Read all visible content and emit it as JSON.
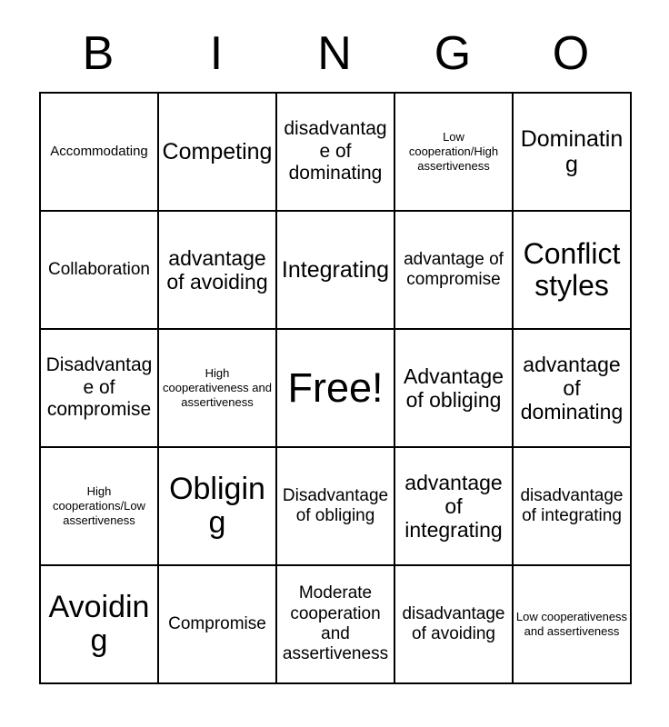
{
  "card": {
    "title_letters": [
      "B",
      "I",
      "N",
      "G",
      "O"
    ],
    "free_space_label": "Free!",
    "rows": [
      [
        {
          "text": "Accommodating",
          "size": "sm"
        },
        {
          "text": "Competing",
          "size": "2xl"
        },
        {
          "text": "disadvantage of dominating",
          "size": "lg"
        },
        {
          "text": "Low cooperation/High assertiveness",
          "size": "xs"
        },
        {
          "text": "Dominating",
          "size": "2xl"
        }
      ],
      [
        {
          "text": "Collaboration",
          "size": "md"
        },
        {
          "text": "advantage of avoiding",
          "size": "xl"
        },
        {
          "text": "Integrating",
          "size": "2xl"
        },
        {
          "text": "advantage of compromise",
          "size": "md"
        },
        {
          "text": "Conflict styles",
          "size": "3xl"
        }
      ],
      [
        {
          "text": "Disadvantage of compromise",
          "size": "lg"
        },
        {
          "text": "High cooperativeness and assertiveness",
          "size": "xs"
        },
        {
          "text": "Free!",
          "size": "free"
        },
        {
          "text": "Advantage of obliging",
          "size": "xl"
        },
        {
          "text": "advantage of dominating",
          "size": "xl"
        }
      ],
      [
        {
          "text": "High cooperations/Low assertiveness",
          "size": "xs"
        },
        {
          "text": "Obliging",
          "size": "4xl"
        },
        {
          "text": "Disadvantage of obliging",
          "size": "md"
        },
        {
          "text": "advantage of integrating",
          "size": "xl"
        },
        {
          "text": "disadvantage of integrating",
          "size": "md"
        }
      ],
      [
        {
          "text": "Avoiding",
          "size": "4xl"
        },
        {
          "text": "Compromise",
          "size": "md"
        },
        {
          "text": "Moderate cooperation and assertiveness",
          "size": "md"
        },
        {
          "text": "disadvantage of avoiding",
          "size": "md"
        },
        {
          "text": "Low cooperativeness and assertiveness",
          "size": "xs"
        }
      ]
    ]
  },
  "colors": {
    "border": "#000000",
    "text": "#000000",
    "background": "#ffffff"
  }
}
